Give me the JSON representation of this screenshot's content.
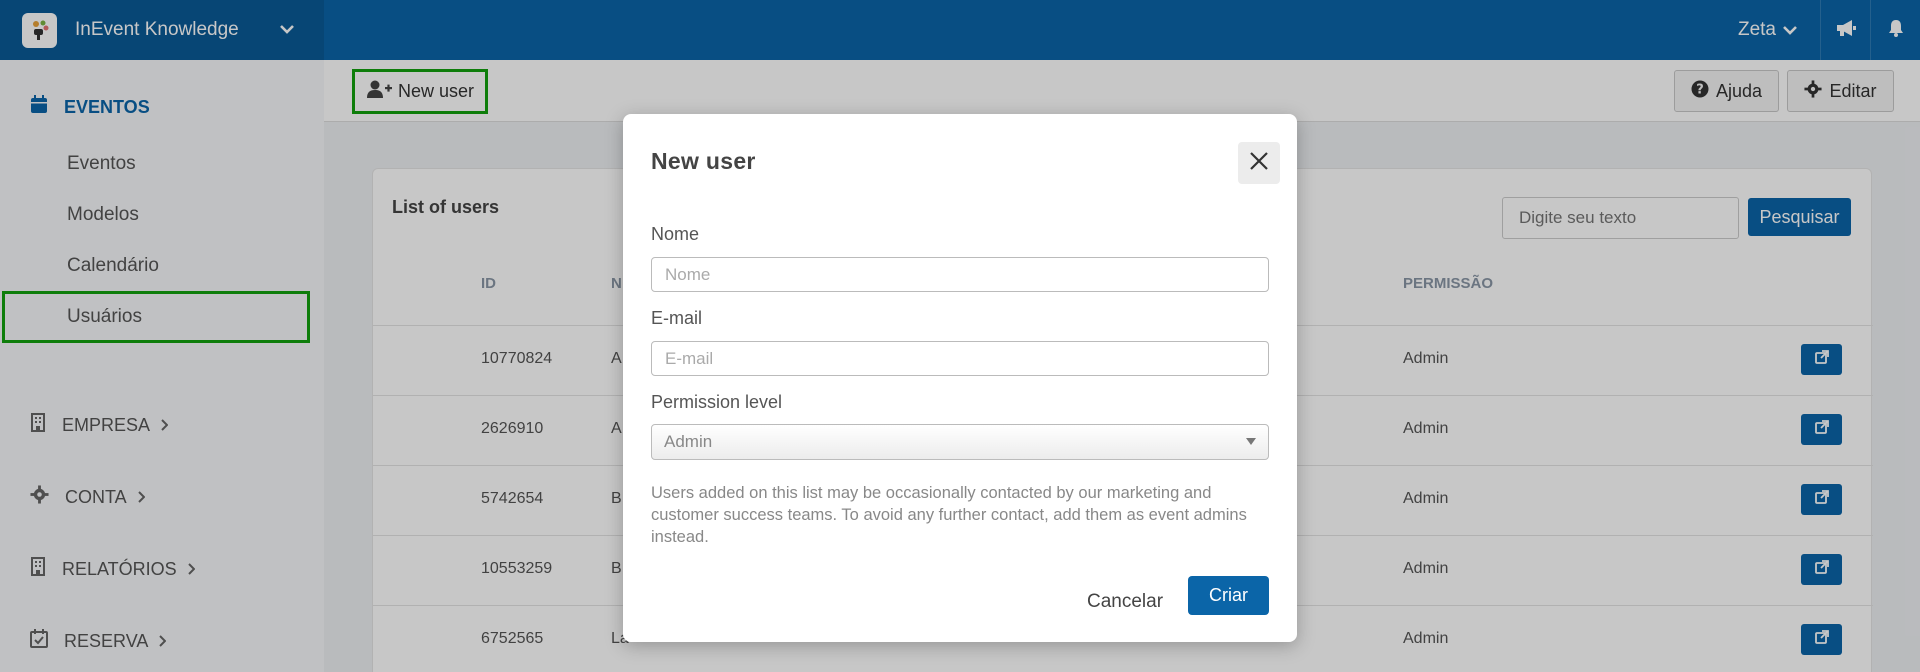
{
  "header": {
    "app_title": "InEvent Knowledge",
    "user_name": "Zeta"
  },
  "sidebar": {
    "sections": [
      {
        "label": "EVENTOS",
        "icon": "calendar-icon"
      },
      {
        "label": "EMPRESA",
        "icon": "building-icon"
      },
      {
        "label": "CONTA",
        "icon": "gear-icon"
      },
      {
        "label": "RELATÓRIOS",
        "icon": "building-icon"
      },
      {
        "label": "RESERVA",
        "icon": "calendar-check-icon"
      }
    ],
    "items": [
      "Eventos",
      "Modelos",
      "Calendário",
      "Usuários"
    ]
  },
  "toolbar": {
    "new_user_label": "New user",
    "help_label": "Ajuda",
    "edit_label": "Editar"
  },
  "list": {
    "title": "List of users",
    "search_placeholder": "Digite seu texto",
    "search_button": "Pesquisar",
    "columns": [
      "ID",
      "N",
      "PERMISSÃO"
    ],
    "rows": [
      {
        "id": "10770824",
        "name": "A",
        "permission": "Admin"
      },
      {
        "id": "2626910",
        "name": "A",
        "permission": "Admin"
      },
      {
        "id": "5742654",
        "name": "B",
        "permission": "Admin"
      },
      {
        "id": "10553259",
        "name": "B",
        "permission": "Admin"
      },
      {
        "id": "6752565",
        "name": "La",
        "permission": "Admin"
      }
    ]
  },
  "modal": {
    "title": "New user",
    "name_label": "Nome",
    "name_placeholder": "Nome",
    "email_label": "E-mail",
    "email_placeholder": "E-mail",
    "permission_label": "Permission level",
    "permission_value": "Admin",
    "note": "Users added on this list may be occasionally contacted by our marketing and customer success teams. To avoid any further contact, add them as event admins instead.",
    "cancel_label": "Cancelar",
    "create_label": "Criar"
  },
  "colors": {
    "primary": "#0b65a8",
    "highlight": "#13a10e"
  }
}
